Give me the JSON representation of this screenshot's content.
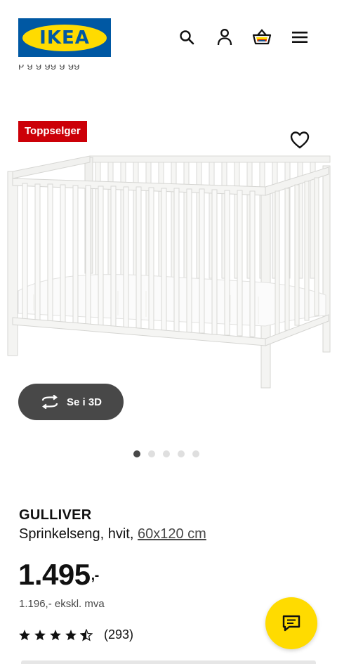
{
  "header": {
    "logo_text": "IKEA",
    "icons": [
      "search-icon",
      "user-icon",
      "basket-icon",
      "menu-icon"
    ],
    "partial_text": "p   g  g  gg  g  gg"
  },
  "product_gallery": {
    "badge": "Toppselger",
    "badge_color": "#cc0008",
    "view_3d_label": "Se i 3D",
    "image_count": 5,
    "active_image": 1
  },
  "product": {
    "name": "GULLIVER",
    "description": "Sprinkelseng, hvit,",
    "size_link": "60x120 cm",
    "price": "1.495",
    "price_suffix": ",-",
    "price_ex_vat": "1.196,- ekskl. mva",
    "rating": 4.5,
    "rating_max": 5,
    "review_count": "(293)"
  },
  "colors": {
    "brand_blue": "#0058a3",
    "brand_yellow": "#ffdb00",
    "dark_gray": "#484848"
  }
}
